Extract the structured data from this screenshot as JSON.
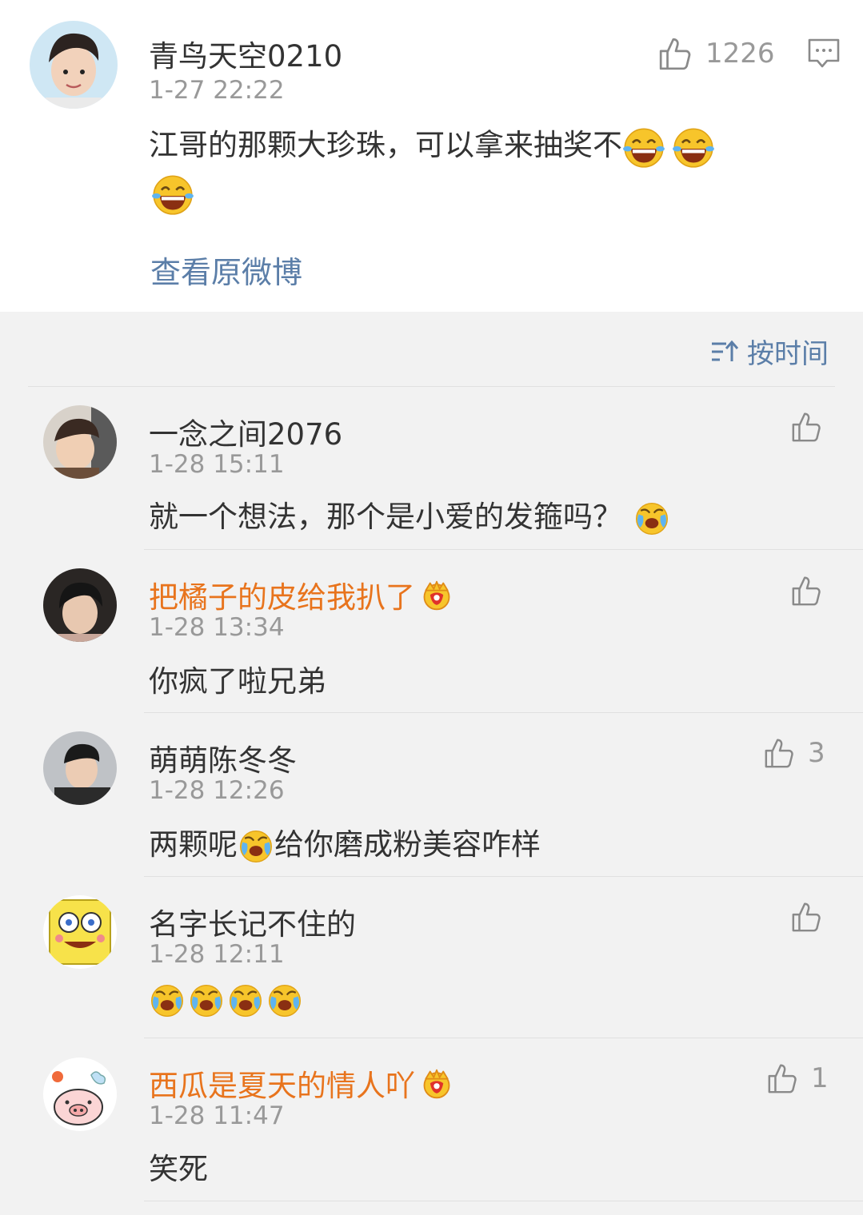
{
  "post": {
    "author": "青鸟天空0210",
    "time": "1-27 22:22",
    "likes": "1226",
    "content": "江哥的那颗大珍珠，可以拿来抽奖不",
    "view_original": "查看原微博",
    "icons": {
      "like": "thumbs-up-icon",
      "comment": "comment-icon",
      "emoji": "laughing-tears-emoji"
    }
  },
  "sort": {
    "label": "按时间",
    "icon": "sort-icon"
  },
  "comments": [
    {
      "author": "一念之间2076",
      "time": "1-28 15:11",
      "text": "就一个想法，那个是小爱的发箍吗？",
      "likes": "",
      "vip": false
    },
    {
      "author": "把橘子的皮给我扒了",
      "time": "1-28 13:34",
      "text": "你疯了啦兄弟",
      "likes": "",
      "vip": true
    },
    {
      "author": "萌萌陈冬冬",
      "time": "1-28 12:26",
      "text_a": "两颗呢",
      "text_b": "给你磨成粉美容咋样",
      "likes": "3",
      "vip": false
    },
    {
      "author": "名字长记不住的",
      "time": "1-28 12:11",
      "text": "",
      "likes": "",
      "vip": false
    },
    {
      "author": "西瓜是夏天的情人吖",
      "time": "1-28 11:47",
      "text": "笑死",
      "likes": "1",
      "vip": true
    }
  ],
  "colors": {
    "vip_name": "#e8741d",
    "link": "#5b7ea8",
    "meta": "#999999",
    "background": "#f2f2f2"
  }
}
